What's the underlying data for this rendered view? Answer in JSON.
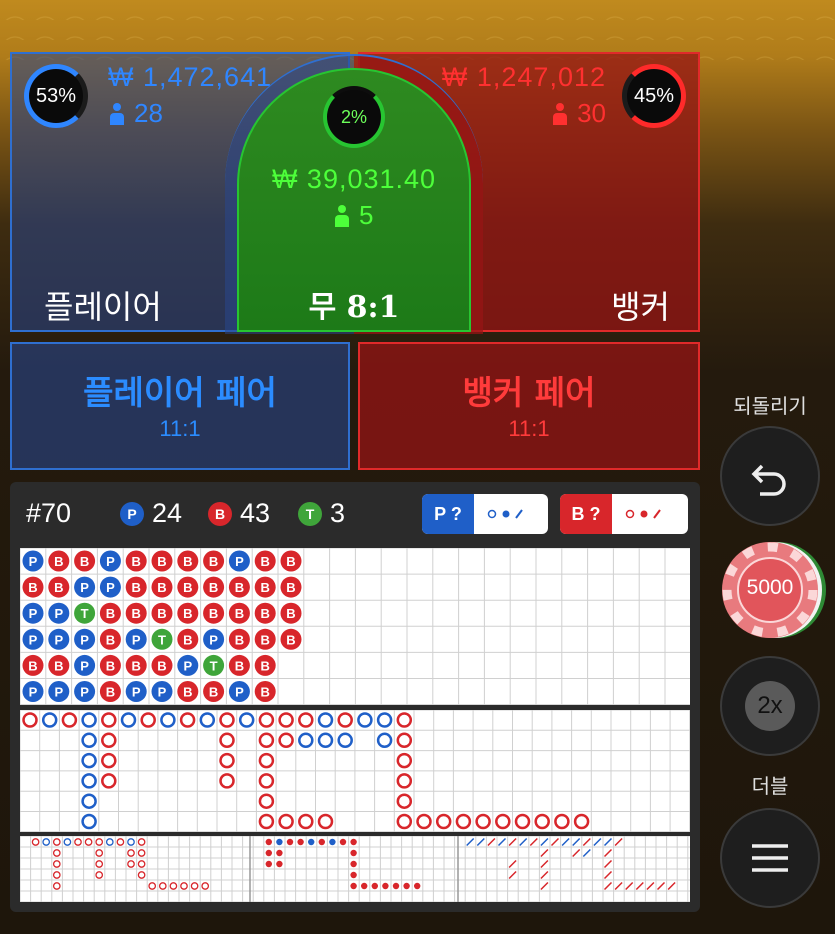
{
  "player": {
    "percent": "53%",
    "amount": "₩ 1,472,641",
    "count": "28",
    "label": "플레이어"
  },
  "tie": {
    "percent": "2%",
    "amount": "₩ 39,031.40",
    "count": "5",
    "label": "무 8:1"
  },
  "banker": {
    "percent": "45%",
    "amount": "₩ 1,247,012",
    "count": "30",
    "label": "뱅커"
  },
  "player_pair": {
    "label": "플레이어 페어",
    "odds": "11:1"
  },
  "banker_pair": {
    "label": "뱅커 페어",
    "odds": "11:1"
  },
  "controls": {
    "undo_label": "되돌리기",
    "chip_value": "5000",
    "double_value": "2x",
    "double_label": "더블"
  },
  "board": {
    "round": "#70",
    "player_count": "24",
    "banker_count": "43",
    "tie_count": "3",
    "player_badge": "P",
    "banker_badge": "B",
    "tie_badge": "T",
    "ask_player": "P ?",
    "ask_banker": "B ?"
  },
  "colors": {
    "player": "#1f5fc8",
    "banker": "#d8262b",
    "tie": "#3fa53a"
  },
  "bead_road": [
    [
      "P",
      "B",
      "B",
      "P",
      "B",
      "B",
      "B",
      "B",
      "P",
      "B",
      "B"
    ],
    [
      "B",
      "B",
      "P",
      "P",
      "B",
      "B",
      "B",
      "B",
      "B",
      "B",
      "B"
    ],
    [
      "P",
      "P",
      "T",
      "B",
      "B",
      "B",
      "B",
      "B",
      "B",
      "B",
      "B"
    ],
    [
      "P",
      "P",
      "P",
      "B",
      "P",
      "T",
      "B",
      "P",
      "B",
      "B",
      "B"
    ],
    [
      "B",
      "B",
      "P",
      "B",
      "B",
      "B",
      "P",
      "T",
      "B",
      "B",
      ""
    ],
    [
      "P",
      "P",
      "P",
      "B",
      "P",
      "P",
      "B",
      "B",
      "P",
      "B",
      ""
    ]
  ]
}
